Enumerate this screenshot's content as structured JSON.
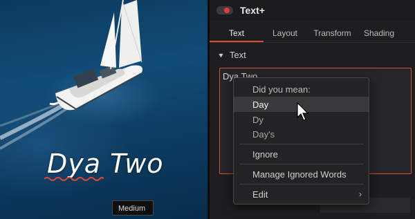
{
  "preview": {
    "overlay_text": "Dya Two"
  },
  "inspector": {
    "title": "Text+",
    "tabs": [
      {
        "label": "Text",
        "active": true
      },
      {
        "label": "Layout",
        "active": false
      },
      {
        "label": "Transform",
        "active": false
      },
      {
        "label": "Shading",
        "active": false
      }
    ],
    "section_title": "Text",
    "text_value": "Dya Two",
    "weight_value": "Medium"
  },
  "context_menu": {
    "header": "Did you mean:",
    "suggestions": [
      "Day",
      "Dy",
      "Day's"
    ],
    "highlighted": "Day",
    "ignore": "Ignore",
    "manage": "Manage Ignored Words",
    "edit": "Edit"
  },
  "colors": {
    "accent": "#d6513a",
    "toggle_dot": "#e23b3b",
    "panel_bg": "#1e1e20"
  },
  "icons": [
    "chevron-down-icon",
    "chevron-right-icon",
    "mouse-pointer-icon"
  ]
}
